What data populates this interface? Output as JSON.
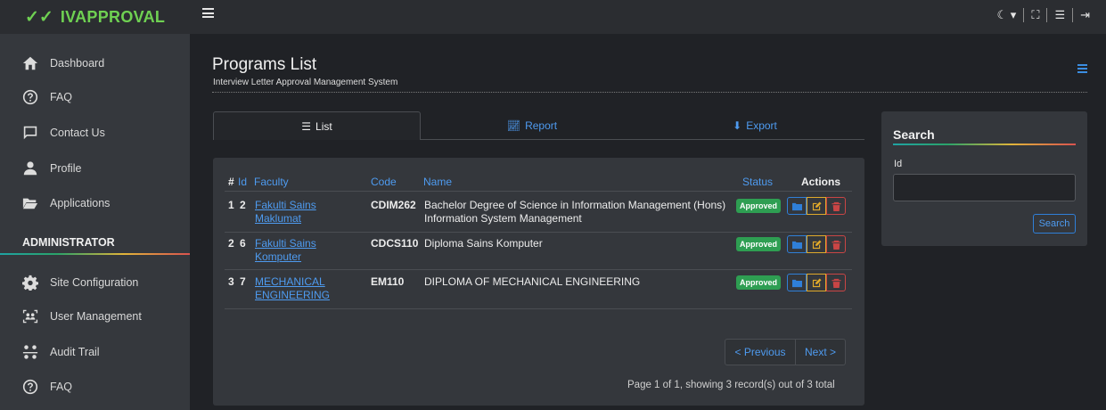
{
  "brand": {
    "name": "IVAPPROVAL"
  },
  "sidebar": {
    "items": [
      {
        "label": "Dashboard",
        "icon": "house-icon"
      },
      {
        "label": "FAQ",
        "icon": "question-icon"
      },
      {
        "label": "Contact Us",
        "icon": "chat-icon"
      },
      {
        "label": "Profile",
        "icon": "user-icon"
      },
      {
        "label": "Applications",
        "icon": "folder-open-icon"
      }
    ],
    "section": "ADMINISTRATOR",
    "admin_items": [
      {
        "label": "Site Configuration",
        "icon": "gear-icon"
      },
      {
        "label": "User Management",
        "icon": "users-icon"
      },
      {
        "label": "Audit Trail",
        "icon": "sitemap-icon"
      },
      {
        "label": "FAQ",
        "icon": "question-icon"
      }
    ]
  },
  "header": {
    "title": "Programs List",
    "subtitle": "Interview Letter Approval Management System"
  },
  "tabs": [
    {
      "label": "List",
      "icon": "list-icon"
    },
    {
      "label": "Report",
      "icon": "chart-line-icon"
    },
    {
      "label": "Export",
      "icon": "download-icon"
    }
  ],
  "table": {
    "columns": {
      "num": "#",
      "id": "Id",
      "faculty": "Faculty",
      "code": "Code",
      "name": "Name",
      "status": "Status",
      "actions": "Actions"
    },
    "rows": [
      {
        "num": "1",
        "id": "2",
        "faculty_line1": "Fakulti Sains",
        "faculty_line2": "Maklumat",
        "code": "CDIM262",
        "name_line1": "Bachelor Degree of Science in Information Management (Hons)",
        "name_line2": "Information System Management",
        "status": "Approved"
      },
      {
        "num": "2",
        "id": "6",
        "faculty_line1": "Fakulti Sains",
        "faculty_line2": "Komputer",
        "code": "CDCS110",
        "name_line1": "Diploma Sains Komputer",
        "name_line2": "",
        "status": "Approved"
      },
      {
        "num": "3",
        "id": "7",
        "faculty_line1": "MECHANICAL",
        "faculty_line2": "ENGINEERING",
        "code": "EM110",
        "name_line1": "DIPLOMA OF MECHANICAL ENGINEERING",
        "name_line2": "",
        "status": "Approved"
      }
    ]
  },
  "pagination": {
    "prev": "< Previous",
    "next": "Next >",
    "info": "Page 1 of 1, showing 3 record(s) out of 3 total"
  },
  "search": {
    "title": "Search",
    "field_label": "Id",
    "value": "",
    "button": "Search"
  },
  "colors": {
    "accent": "#4e9bf0",
    "brand": "#6fd152",
    "approved": "#2e9e52"
  }
}
